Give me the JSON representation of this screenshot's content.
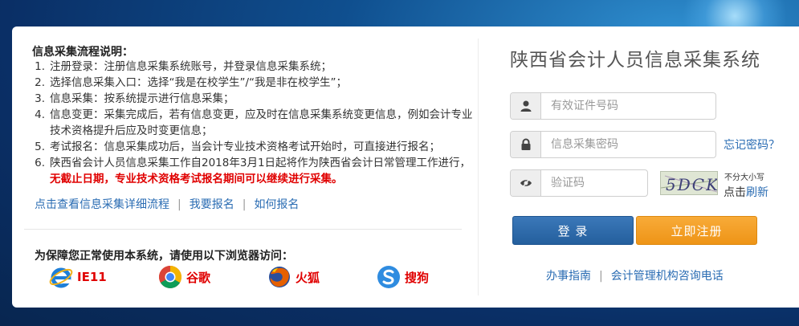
{
  "process": {
    "title": "信息采集流程说明：",
    "steps": [
      {
        "num": "1.",
        "text": "注册登录：注册信息采集系统账号，并登录信息采集系统；"
      },
      {
        "num": "2.",
        "text": "选择信息采集入口：选择“我是在校学生”/“我是非在校学生”；"
      },
      {
        "num": "3.",
        "text": "信息采集：按系统提示进行信息采集；"
      },
      {
        "num": "4.",
        "text": "信息变更：采集完成后，若有信息变更，应及时在信息采集系统变更信息，例如会计专业技术资格提升后应及时变更信息；"
      },
      {
        "num": "5.",
        "text": "考试报名：信息采集成功后，当会计专业技术资格考试开始时，可直接进行报名；"
      },
      {
        "num": "6.",
        "text": "陕西省会计人员信息采集工作自2018年3月1日起将作为陕西省会计日常管理工作进行，",
        "red": "无截止日期，专业技术资格考试报名期间可以继续进行采集。"
      }
    ]
  },
  "links": {
    "detail": "点击查看信息采集详细流程",
    "signup": "我要报名",
    "howto": "如何报名"
  },
  "browsers": {
    "title": "为保障您正常使用本系统，请使用以下浏览器访问：",
    "items": [
      "IE11",
      "谷歌",
      "火狐",
      "搜狗"
    ]
  },
  "login": {
    "title": "陕西省会计人员信息采集系统",
    "id_placeholder": "有效证件号码",
    "pwd_placeholder": "信息采集密码",
    "captcha_placeholder": "验证码",
    "forgot": "忘记密码？",
    "captcha_text": "5DCK",
    "case_hint": "不分大小写",
    "refresh_prefix": "点击",
    "refresh_link": "刷新",
    "login_btn": "登 录",
    "register_btn": "立即注册",
    "guide": "办事指南",
    "contact": "会计管理机构咨询电话"
  }
}
